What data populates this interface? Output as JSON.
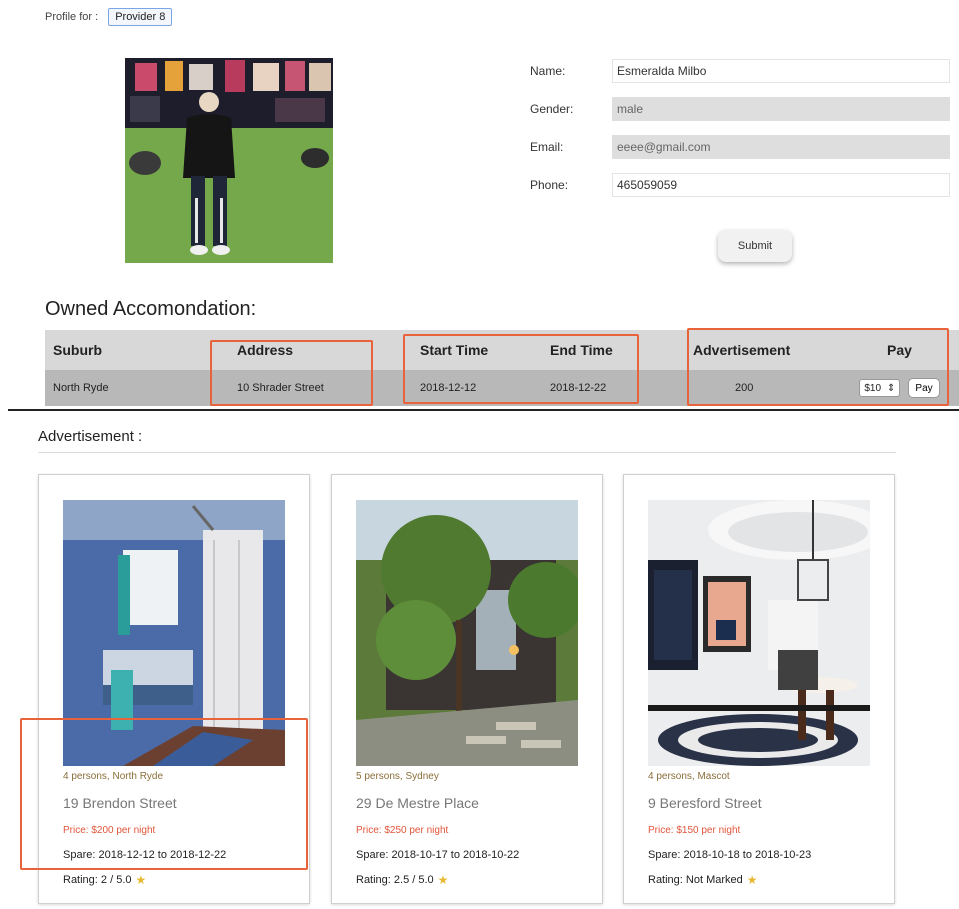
{
  "profile": {
    "label": "Profile for :",
    "selected_user": "Provider 8"
  },
  "form": {
    "name_label": "Name:",
    "name_value": "Esmeralda Milbo",
    "gender_label": "Gender:",
    "gender_value": "male",
    "email_label": "Email:",
    "email_value": "eeee@gmail.com",
    "phone_label": "Phone:",
    "phone_value": "465059059",
    "submit_label": "Submit"
  },
  "owned": {
    "title": "Owned Accomondation:",
    "headers": {
      "suburb": "Suburb",
      "address": "Address",
      "start": "Start Time",
      "end": "End Time",
      "advertisement": "Advertisement",
      "pay": "Pay"
    },
    "rows": [
      {
        "suburb": "North Ryde",
        "address": "10 Shrader Street",
        "start": "2018-12-12",
        "end": "2018-12-22",
        "advertisement": "200",
        "pay_select": "$10",
        "pay_button": "Pay"
      }
    ]
  },
  "advertisement": {
    "title": "Advertisement :",
    "cards": [
      {
        "meta": "4 persons,  North Ryde",
        "address": "19 Brendon Street",
        "price": "Price: $200 per night",
        "span": "Spare: 2018-12-12 to 2018-12-22",
        "rating": "Rating: 2 / 5.0"
      },
      {
        "meta": "5 persons,  Sydney",
        "address": "29 De Mestre Place",
        "price": "Price: $250 per night",
        "span": "Spare: 2018-10-17 to 2018-10-22",
        "rating": "Rating: 2.5 / 5.0"
      },
      {
        "meta": "4 persons,  Mascot",
        "address": "9 Beresford Street",
        "price": "Price: $150 per night",
        "span": "Spare: 2018-10-18 to 2018-10-23",
        "rating": "Rating: Not Marked"
      }
    ]
  },
  "colors": {
    "highlight": "#e8633a",
    "star": "#e8b830",
    "price": "#e0553a"
  }
}
